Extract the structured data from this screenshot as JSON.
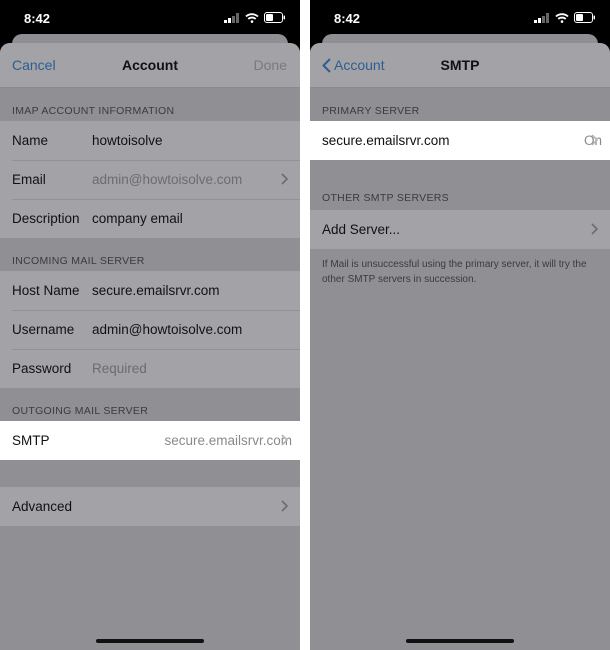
{
  "left": {
    "status_time": "8:42",
    "nav": {
      "cancel": "Cancel",
      "title": "Account",
      "done": "Done"
    },
    "imap_header": "IMAP ACCOUNT INFORMATION",
    "imap_rows": [
      {
        "label": "Name",
        "value": "howtoisolve"
      },
      {
        "label": "Email",
        "value": "admin@howtoisolve.com"
      },
      {
        "label": "Description",
        "value": "company email"
      }
    ],
    "incoming_header": "INCOMING MAIL SERVER",
    "incoming_rows": [
      {
        "label": "Host Name",
        "value": "secure.emailsrvr.com"
      },
      {
        "label": "Username",
        "value": "admin@howtoisolve.com"
      },
      {
        "label": "Password",
        "placeholder": "Required"
      }
    ],
    "outgoing_header": "OUTGOING MAIL SERVER",
    "smtp": {
      "label": "SMTP",
      "value": "secure.emailsrvr.com"
    },
    "advanced": "Advanced"
  },
  "right": {
    "status_time": "8:42",
    "nav": {
      "back": "Account",
      "title": "SMTP"
    },
    "primary_header": "PRIMARY SERVER",
    "primary": {
      "label": "secure.emailsrvr.com",
      "status": "On"
    },
    "other_header": "OTHER SMTP SERVERS",
    "add_server": "Add Server...",
    "footnote": "If Mail is unsuccessful using the primary server, it will try the other SMTP servers in succession."
  },
  "colors": {
    "accent": "#2d5d92",
    "highlight": "#ffffff",
    "dim_background": "#909094"
  }
}
